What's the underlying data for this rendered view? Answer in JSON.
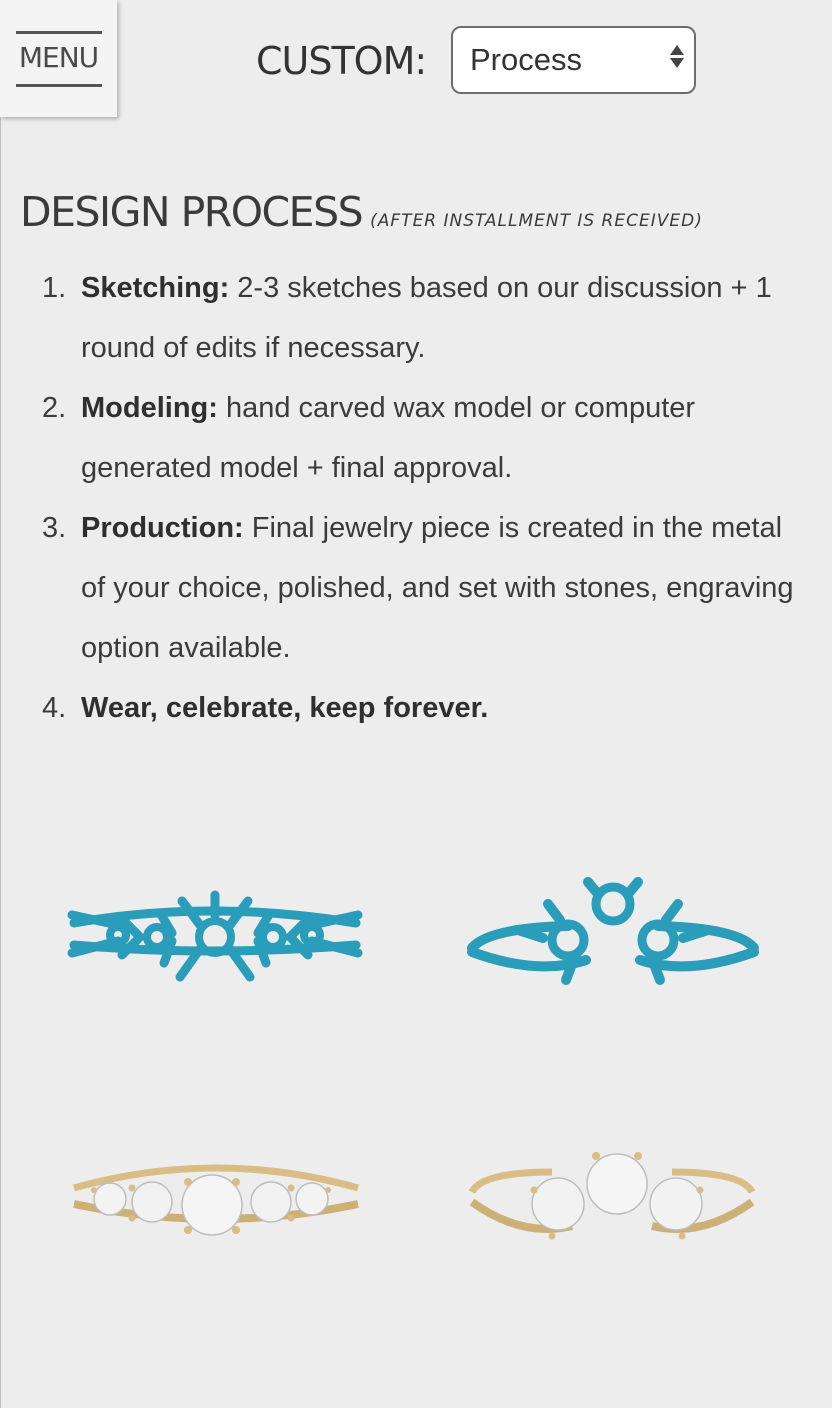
{
  "header": {
    "menu_label": "MENU",
    "custom_label": "CUSTOM:",
    "select_value": "Process"
  },
  "section": {
    "title": "DESIGN PROCESS",
    "subtitle": "(AFTER INSTALLMENT IS RECEIVED)"
  },
  "steps": [
    {
      "num": "1.",
      "bold": "Sketching:",
      "text": " 2-3 sketches based on our discussion + 1 round of edits if necessary."
    },
    {
      "num": "2.",
      "bold": "Modeling:",
      "text": " hand carved wax model or computer generated model + final approval."
    },
    {
      "num": "3.",
      "bold": "Production:",
      "text": " Final jewelry piece is created in the metal of your choice, polished, and set with stones, engraving option available."
    },
    {
      "num": "4.",
      "bold": "Wear, celebrate, keep forever.",
      "text": ""
    }
  ],
  "colors": {
    "wax_blue": "#2a9dbb",
    "gold": "#d9bd84",
    "diamond": "#f2f2f2",
    "background": "#ededed"
  },
  "images": [
    {
      "name": "blue-wax-ring-straight",
      "type": "wax model"
    },
    {
      "name": "blue-wax-ring-curved",
      "type": "wax model"
    },
    {
      "name": "gold-diamond-ring-straight",
      "type": "finished ring"
    },
    {
      "name": "gold-diamond-ring-curved",
      "type": "finished ring"
    }
  ]
}
